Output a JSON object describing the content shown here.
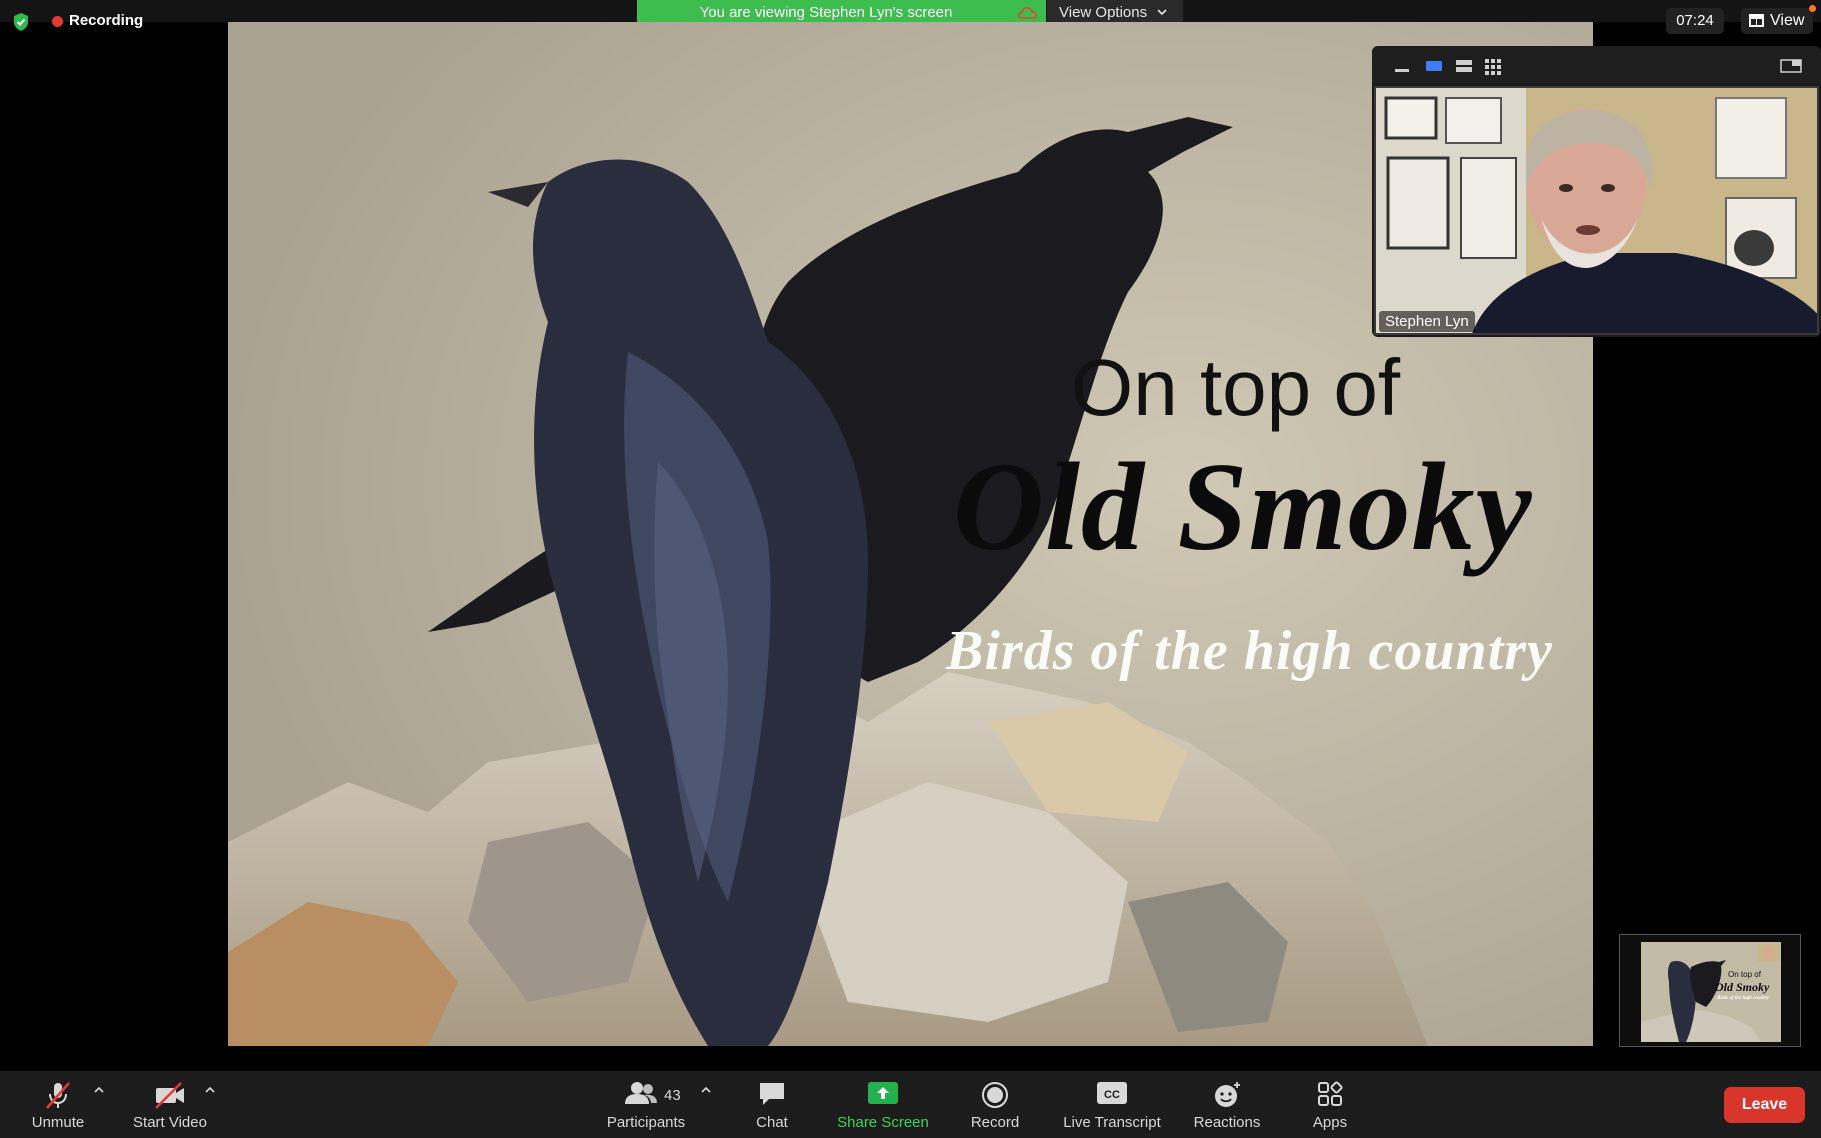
{
  "top_bar": {
    "recording_label": "Recording",
    "viewing_banner": "You are viewing Stephen Lyn's screen",
    "view_options_label": "View Options",
    "clock": "07:24",
    "view_label": "View"
  },
  "slide": {
    "line1": "On top of",
    "line2": "Old Smoky",
    "line3": "Birds of the high country"
  },
  "video": {
    "participant_name": "Stephen Lyn"
  },
  "thumbnail": {
    "line1": "On top of",
    "line2": "Old Smoky",
    "line3": "Birds of the high country"
  },
  "toolbar": {
    "unmute": "Unmute",
    "start_video": "Start Video",
    "participants_count": "43",
    "participants": "Participants",
    "chat": "Chat",
    "share_screen": "Share Screen",
    "record": "Record",
    "live_transcript": "Live Transcript",
    "reactions": "Reactions",
    "apps": "Apps",
    "leave": "Leave"
  },
  "colors": {
    "banner_green": "#3dbd4d",
    "leave_red": "#d9362b",
    "recording_red": "#e53935",
    "share_green": "#22b14c",
    "active_layout_blue": "#3d7bf7"
  }
}
